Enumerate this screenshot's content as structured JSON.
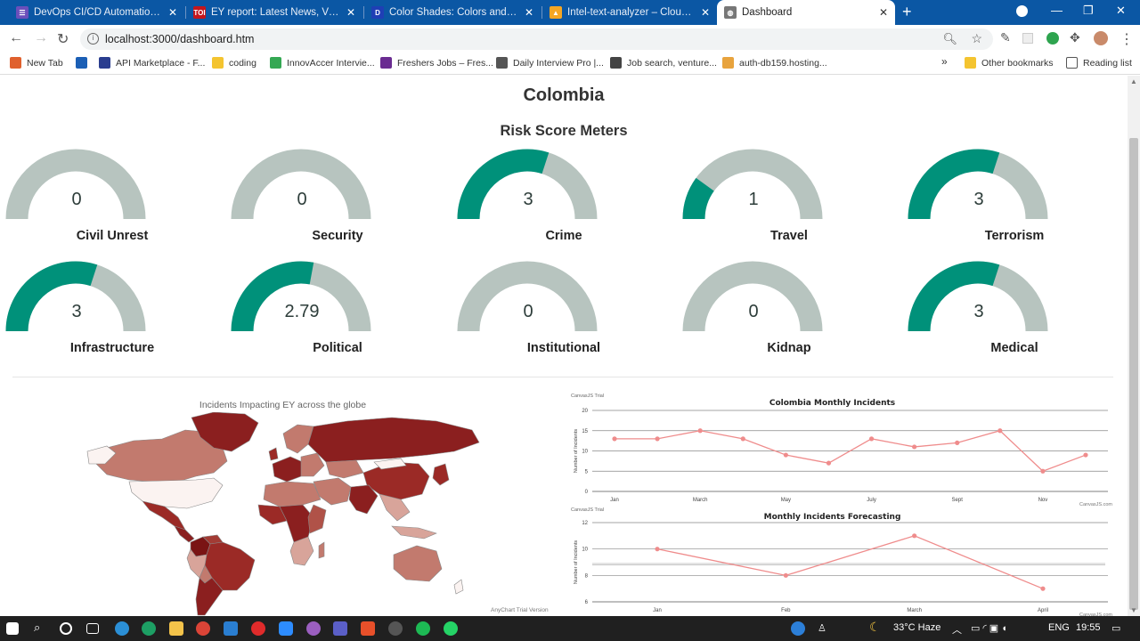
{
  "browser": {
    "tabs": [
      {
        "title": "DevOps CI/CD Automation - Jenk",
        "icon": "devops-icon",
        "color": "#6b4fbb",
        "glyph": "☰"
      },
      {
        "title": "EY report: Latest News, Videos an",
        "icon": "toi-icon",
        "color": "#c4161c",
        "glyph": "TOI"
      },
      {
        "title": "Color Shades: Colors and Lighter",
        "icon": "color-icon",
        "color": "#1f3fb5",
        "glyph": "D"
      },
      {
        "title": "Intel-text-analyzer – Cloud Firest",
        "icon": "firebase-icon",
        "color": "#f5a623",
        "glyph": "▲"
      },
      {
        "title": "Dashboard",
        "icon": "globe-icon",
        "color": "#777777",
        "glyph": "◍"
      }
    ],
    "url": "localhost:3000/dashboard.htm",
    "bookmarks": [
      {
        "label": "New Tab",
        "color": "#e0602d"
      },
      {
        "label": "",
        "color": "#1b5fb5"
      },
      {
        "label": "API Marketplace - F...",
        "color": "#2a3d8f"
      },
      {
        "label": "coding",
        "color": "#f4c430"
      },
      {
        "label": "InnovAccer Intervie...",
        "color": "#34a853"
      },
      {
        "label": "Freshers Jobs – Fres...",
        "color": "#6a2c91"
      },
      {
        "label": "Daily Interview Pro |...",
        "color": "#555555"
      },
      {
        "label": "Job search, venture...",
        "color": "#444444"
      },
      {
        "label": "auth-db159.hosting...",
        "color": "#e8a33d"
      }
    ],
    "bookmarks_more": "»",
    "other_bookmarks": "Other bookmarks",
    "reading_list": "Reading list"
  },
  "dashboard": {
    "country": "Colombia",
    "section_title": "Risk Score Meters",
    "gauge_max": 5,
    "gauge_fill_color": "#00917a",
    "gauge_track_color": "#b7c4bf",
    "gauges": [
      {
        "label": "Civil Unrest",
        "value": 0,
        "display": "0"
      },
      {
        "label": "Security",
        "value": 0,
        "display": "0"
      },
      {
        "label": "Crime",
        "value": 3,
        "display": "3"
      },
      {
        "label": "Travel",
        "value": 1,
        "display": "1"
      },
      {
        "label": "Terrorism",
        "value": 3,
        "display": "3"
      },
      {
        "label": "Infrastructure",
        "value": 3,
        "display": "3"
      },
      {
        "label": "Political",
        "value": 2.79,
        "display": "2.79"
      },
      {
        "label": "Institutional",
        "value": 0,
        "display": "0"
      },
      {
        "label": "Kidnap",
        "value": 0,
        "display": "0"
      },
      {
        "label": "Medical",
        "value": 3,
        "display": "3"
      }
    ],
    "map": {
      "title": "Incidents Impacting EY across the globe",
      "trial_note": "AnyChart Trial Version"
    }
  },
  "chart_data": [
    {
      "type": "line",
      "title": "Colombia Monthly Incidents",
      "trial_note": "CanvasJS Trial",
      "credit": "CanvasJS.com",
      "xlabel": "",
      "ylabel": "Number of Incidents",
      "ylim": [
        0,
        20
      ],
      "yticks": [
        0,
        5,
        10,
        15,
        20
      ],
      "xtick_labels": [
        "Jan",
        "March",
        "May",
        "July",
        "Sept",
        "Nov"
      ],
      "x": [
        "Jan",
        "Feb",
        "March",
        "April",
        "May",
        "June",
        "July",
        "Aug",
        "Sept",
        "Oct",
        "Nov",
        "Dec"
      ],
      "values": [
        13,
        13,
        15,
        13,
        9,
        7,
        13,
        11,
        12,
        15,
        5,
        9
      ],
      "grid": true,
      "line_color": "#ef8c8c"
    },
    {
      "type": "line",
      "title": "Monthly Incidents Forecasting",
      "trial_note": "CanvasJS Trial",
      "credit": "CanvasJS.com",
      "xlabel": "",
      "ylabel": "Number of Incidents",
      "ylim": [
        6,
        12
      ],
      "yticks": [
        6,
        8,
        10,
        12
      ],
      "x": [
        "Jan",
        "Feb",
        "March",
        "April"
      ],
      "values": [
        10,
        8,
        11,
        7
      ],
      "grid": true,
      "line_color": "#ef8c8c"
    }
  ],
  "taskbar": {
    "weather": "33°C  Haze",
    "lang": "ENG",
    "time": "19:55"
  }
}
